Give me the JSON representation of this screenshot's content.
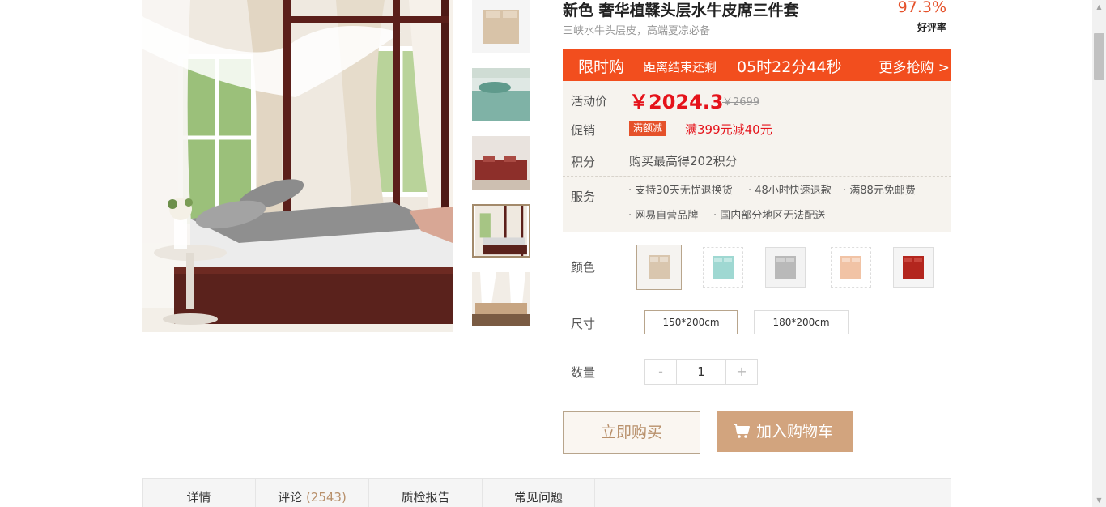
{
  "product": {
    "title": "新色 奢华植鞣头层水牛皮席三件套",
    "subtitle": "三峡水牛头层皮，高端夏凉必备",
    "rating_value": "97.3%",
    "rating_label": "好评率"
  },
  "flash_sale": {
    "title": "限时购",
    "countdown_label": "距离结束还剩",
    "countdown": "05时22分44秒",
    "more_link": "更多抢购 >"
  },
  "pricing": {
    "label": "活动价",
    "current": "￥2024.3",
    "original": "￥2699"
  },
  "promotion": {
    "label": "促销",
    "tag": "满额减",
    "text": "满399元减40元"
  },
  "points": {
    "label": "积分",
    "text": "购买最高得202积分"
  },
  "service": {
    "label": "服务",
    "items": [
      "· 支持30天无忧退换货",
      "· 48小时快速退款",
      "· 满88元免邮费",
      "· 网易自营品牌",
      "· 国内部分地区无法配送"
    ]
  },
  "color": {
    "label": "颜色",
    "options": [
      {
        "name": "beige-swatch",
        "color": "#d9c6ae"
      },
      {
        "name": "aqua-swatch",
        "color": "#9fd8d2"
      },
      {
        "name": "grey-swatch",
        "color": "#b9b9b9"
      },
      {
        "name": "peach-swatch",
        "color": "#f1c3a5"
      },
      {
        "name": "red-swatch",
        "color": "#b3261e"
      }
    ],
    "selected_index": 0
  },
  "size": {
    "label": "尺寸",
    "options": [
      "150*200cm",
      "180*200cm"
    ],
    "selected_index": 0
  },
  "quantity": {
    "label": "数量",
    "minus": "-",
    "value": "1",
    "plus": "+"
  },
  "actions": {
    "buy_now": "立即购买",
    "add_to_cart": "加入购物车"
  },
  "tabs": [
    {
      "label": "详情",
      "count": ""
    },
    {
      "label": "评论",
      "count": "(2543)"
    },
    {
      "label": "质检报告",
      "count": ""
    },
    {
      "label": "常见问题",
      "count": ""
    }
  ],
  "colors": {
    "accent": "#f24e1e",
    "price_red": "#e5131b",
    "panel_bg": "#f6f3ee",
    "cart_button": "#d2a47e",
    "brand_gold": "#b8906b"
  }
}
